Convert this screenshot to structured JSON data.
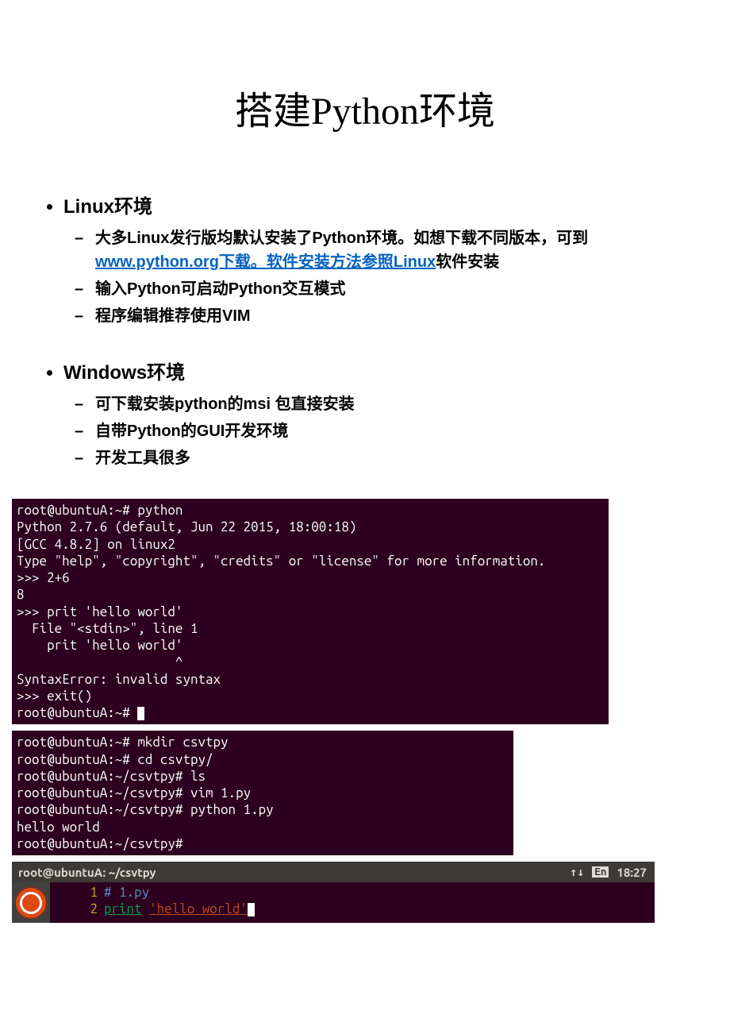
{
  "title": "搭建Python环境",
  "sections": [
    {
      "heading": "Linux环境",
      "items": [
        {
          "pre": "大多Linux发行版均默认安装了Python环境。如想下载不同版本，可到",
          "link": "www.python.org下载。软件安装方法参照Linux",
          "post": "软件安装"
        },
        {
          "text": "输入Python可启动Python交互模式"
        },
        {
          "text": "程序编辑推荐使用VIM"
        }
      ]
    },
    {
      "heading": "Windows环境",
      "items": [
        {
          "text": "可下载安装python的msi 包直接安装"
        },
        {
          "text": "自带Python的GUI开发环境"
        },
        {
          "text": "开发工具很多"
        }
      ]
    }
  ],
  "terminal1": "root@ubuntuA:~# python\nPython 2.7.6 (default, Jun 22 2015, 18:00:18)\n[GCC 4.8.2] on linux2\nType \"help\", \"copyright\", \"credits\" or \"license\" for more information.\n>>> 2+6\n8\n>>> prit 'hello world'\n  File \"<stdin>\", line 1\n    prit 'hello world'\n                     ^\nSyntaxError: invalid syntax\n>>> exit()\nroot@ubuntuA:~# ",
  "terminal2": "root@ubuntuA:~# mkdir csvtpy\nroot@ubuntuA:~# cd csvtpy/\nroot@ubuntuA:~/csvtpy# ls\nroot@ubuntuA:~/csvtpy# vim 1.py\nroot@ubuntuA:~/csvtpy# python 1.py\nhello world\nroot@ubuntuA:~/csvtpy#",
  "titlebar": {
    "title": "root@ubuntuA: ~/csvtpy",
    "lang": "En",
    "time": "18:27"
  },
  "editor": {
    "line1_num": "1",
    "line1_comment": "# 1.py",
    "line2_num": "2",
    "line2_keyword": "print",
    "line2_string": "'hello world'"
  }
}
